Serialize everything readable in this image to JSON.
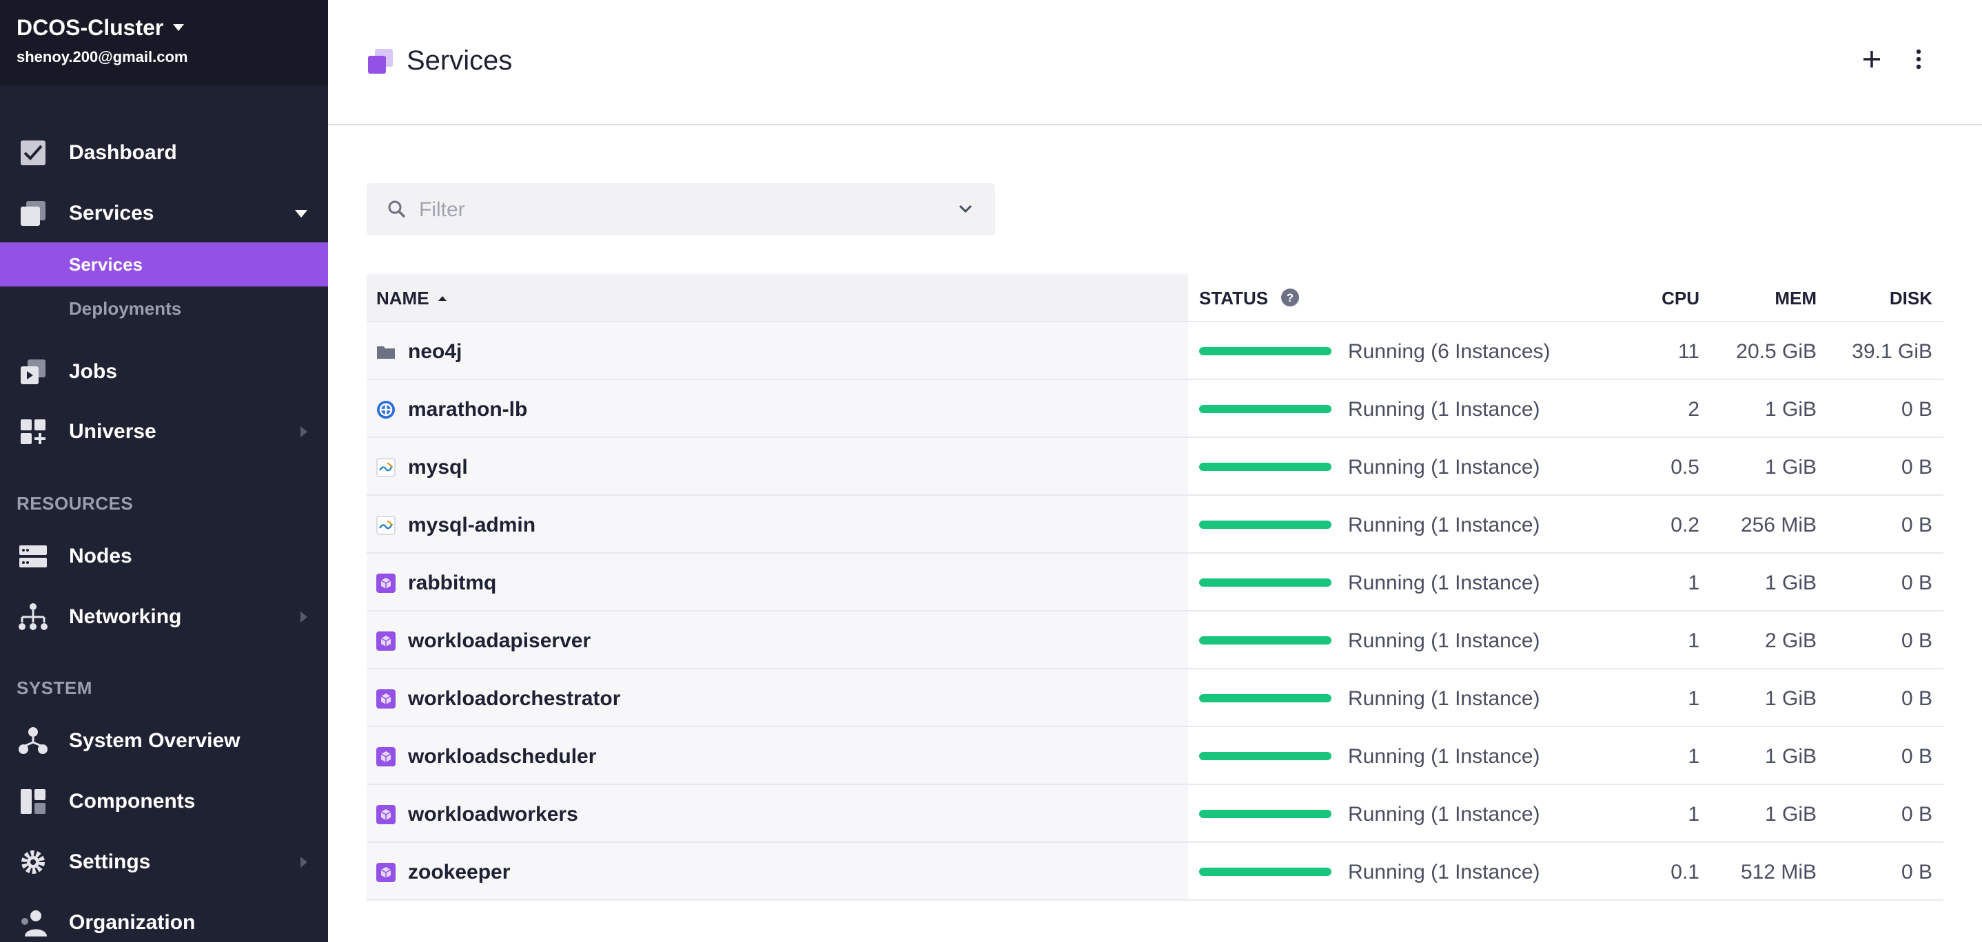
{
  "cluster": {
    "name": "DCOS-Cluster",
    "user": "shenoy.200@gmail.com"
  },
  "sidebar": {
    "items": [
      {
        "label": "Dashboard",
        "icon": "dashboard-icon"
      },
      {
        "label": "Services",
        "icon": "services-icon"
      },
      {
        "label": "Jobs",
        "icon": "jobs-icon"
      },
      {
        "label": "Universe",
        "icon": "universe-icon"
      },
      {
        "label": "Nodes",
        "icon": "nodes-icon"
      },
      {
        "label": "Networking",
        "icon": "networking-icon"
      },
      {
        "label": "System Overview",
        "icon": "system-overview-icon"
      },
      {
        "label": "Components",
        "icon": "components-icon"
      },
      {
        "label": "Settings",
        "icon": "settings-icon"
      },
      {
        "label": "Organization",
        "icon": "organization-icon"
      }
    ],
    "services_sub": [
      {
        "label": "Services"
      },
      {
        "label": "Deployments"
      }
    ],
    "sections": {
      "resources": "RESOURCES",
      "system": "SYSTEM"
    }
  },
  "header": {
    "title": "Services"
  },
  "filter": {
    "placeholder": "Filter"
  },
  "table": {
    "columns": {
      "name": "NAME",
      "status": "STATUS",
      "cpu": "CPU",
      "mem": "MEM",
      "disk": "DISK"
    },
    "rows": [
      {
        "name": "neo4j",
        "icon": "folder-icon",
        "status": "Running (6 Instances)",
        "progress": 1.0,
        "cpu": "11",
        "mem": "20.5 GiB",
        "disk": "39.1 GiB"
      },
      {
        "name": "marathon-lb",
        "icon": "marathon-lb-icon",
        "status": "Running (1 Instance)",
        "progress": 1.0,
        "cpu": "2",
        "mem": "1 GiB",
        "disk": "0 B"
      },
      {
        "name": "mysql",
        "icon": "mysql-icon",
        "status": "Running (1 Instance)",
        "progress": 1.0,
        "cpu": "0.5",
        "mem": "1 GiB",
        "disk": "0 B"
      },
      {
        "name": "mysql-admin",
        "icon": "mysql-icon",
        "status": "Running (1 Instance)",
        "progress": 1.0,
        "cpu": "0.2",
        "mem": "256 MiB",
        "disk": "0 B"
      },
      {
        "name": "rabbitmq",
        "icon": "service-cube-icon",
        "status": "Running (1 Instance)",
        "progress": 1.0,
        "cpu": "1",
        "mem": "1 GiB",
        "disk": "0 B"
      },
      {
        "name": "workloadapiserver",
        "icon": "service-cube-icon",
        "status": "Running (1 Instance)",
        "progress": 1.0,
        "cpu": "1",
        "mem": "2 GiB",
        "disk": "0 B"
      },
      {
        "name": "workloadorchestrator",
        "icon": "service-cube-icon",
        "status": "Running (1 Instance)",
        "progress": 1.0,
        "cpu": "1",
        "mem": "1 GiB",
        "disk": "0 B"
      },
      {
        "name": "workloadscheduler",
        "icon": "service-cube-icon",
        "status": "Running (1 Instance)",
        "progress": 1.0,
        "cpu": "1",
        "mem": "1 GiB",
        "disk": "0 B"
      },
      {
        "name": "workloadworkers",
        "icon": "service-cube-icon",
        "status": "Running (1 Instance)",
        "progress": 1.0,
        "cpu": "1",
        "mem": "1 GiB",
        "disk": "0 B"
      },
      {
        "name": "zookeeper",
        "icon": "service-cube-icon",
        "status": "Running (1 Instance)",
        "progress": 1.0,
        "cpu": "0.1",
        "mem": "512 MiB",
        "disk": "0 B"
      }
    ]
  },
  "colors": {
    "sidebar_bg": "#1f2233",
    "accent": "#9351e5",
    "status_green": "#19c47d"
  }
}
